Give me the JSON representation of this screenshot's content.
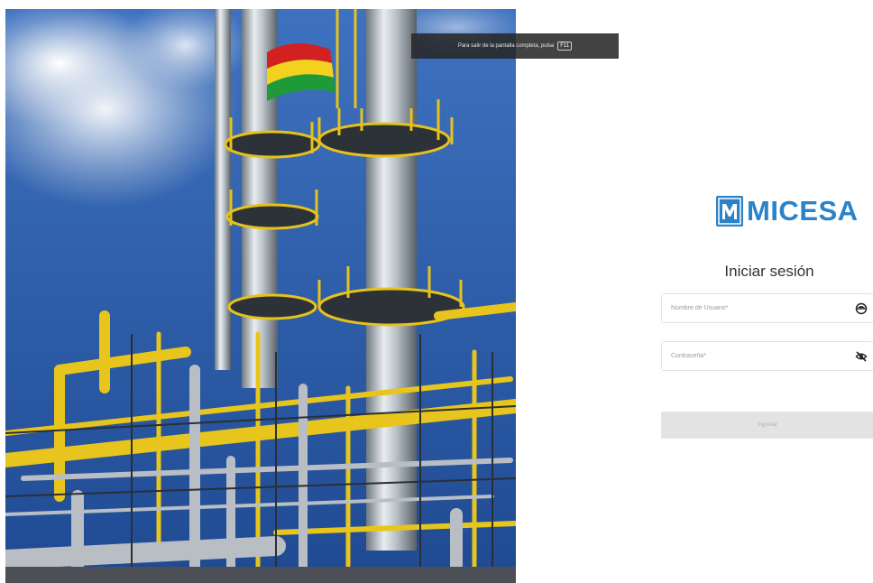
{
  "fullscreen_notice": {
    "text": "Para salir de la pantalla completa, pulsa",
    "key": "F11"
  },
  "brand": {
    "name": "MICESA",
    "color": "#2a82c9"
  },
  "login": {
    "title": "Iniciar sesión",
    "username_placeholder": "Nombre de Usuario*",
    "password_placeholder": "Contraseña*",
    "submit_label": "Ingresar",
    "username_icon": "user-circle-icon",
    "password_icon": "eye-slash-icon"
  }
}
